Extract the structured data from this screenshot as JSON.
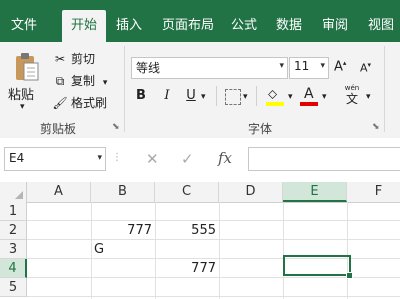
{
  "colors": {
    "accent": "#217346",
    "ribbon_bg": "#f3f3f3",
    "selected_header_bg": "#d2e6d9"
  },
  "tabs": [
    {
      "label": "文件",
      "active": false
    },
    {
      "label": "开始",
      "active": true
    },
    {
      "label": "插入",
      "active": false
    },
    {
      "label": "页面布局",
      "active": false
    },
    {
      "label": "公式",
      "active": false
    },
    {
      "label": "数据",
      "active": false
    },
    {
      "label": "审阅",
      "active": false
    },
    {
      "label": "视图",
      "active": false
    }
  ],
  "clipboard": {
    "paste_label": "粘贴",
    "cut_label": "剪切",
    "copy_label": "复制",
    "format_painter_label": "格式刷",
    "group_label": "剪贴板"
  },
  "font": {
    "family_value": "等线",
    "size_value": "11",
    "grow_label": "A",
    "shrink_label": "A",
    "bold_label": "B",
    "italic_label": "I",
    "underline_label": "U",
    "font_color_label": "A",
    "phonetic_label": "wén",
    "phonetic_glyph": "文",
    "group_label": "字体"
  },
  "formula_bar": {
    "name_box_value": "E4",
    "cancel_glyph": "✕",
    "enter_glyph": "✓",
    "fx_label": "fx",
    "formula_value": ""
  },
  "grid": {
    "columns": [
      "A",
      "B",
      "C",
      "D",
      "E",
      "F"
    ],
    "selected_column": "E",
    "rows": [
      "1",
      "2",
      "3",
      "4",
      "5"
    ],
    "selected_row": "4",
    "cells": {
      "B2": "777",
      "C2": "555",
      "B3": "G",
      "C4": "777"
    },
    "active_cell": "E4"
  }
}
